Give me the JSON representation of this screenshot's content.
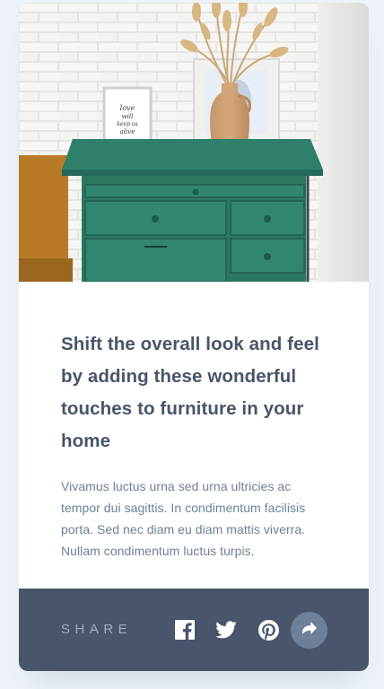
{
  "article": {
    "title": "Shift the overall look and feel by adding these wonderful touches to furniture in your home",
    "description": "Vivamus luctus urna sed urna ultricies ac tempor dui sagittis. In condimentum facilisis porta. Sed nec diam eu diam mattis viverra. Nullam condimentum luctus turpis."
  },
  "hero": {
    "frame_text": "love will keep us alive"
  },
  "share": {
    "label": "SHARE",
    "icons": [
      "facebook-icon",
      "twitter-icon",
      "pinterest-icon",
      "share-icon"
    ]
  },
  "colors": {
    "page_bg": "#ecf2f8",
    "title": "#48556a",
    "body_text": "#6e8098",
    "share_bar": "#48556a",
    "share_label": "#9eafc2",
    "share_button": "#6e8098",
    "dresser": "#2e7d67"
  }
}
